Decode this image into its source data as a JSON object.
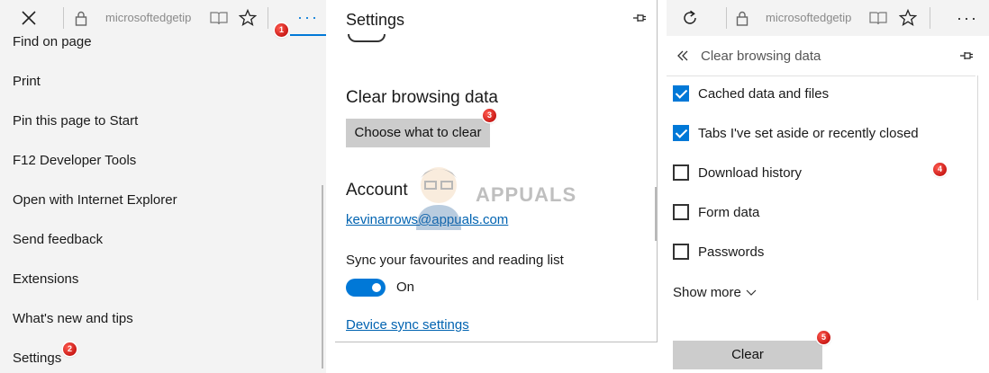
{
  "panel1": {
    "toolbar": {
      "url": "microsoftedgetip",
      "close_icon": "close-icon",
      "lock_icon": "lock-icon",
      "reading_icon": "reading-view-icon",
      "favorite_icon": "star-icon",
      "more": "···"
    },
    "badge": "1",
    "menu": [
      "Find on page",
      "Print",
      "Pin this page to Start",
      "F12 Developer Tools",
      "Open with Internet Explorer",
      "Send feedback",
      "Extensions",
      "What's new and tips",
      "Settings"
    ],
    "settings_badge": "2"
  },
  "panel2": {
    "title": "Settings",
    "pin_icon": "pin-icon",
    "clear_heading": "Clear browsing data",
    "choose_button": "Choose what to clear",
    "choose_badge": "3",
    "account_heading": "Account",
    "account_email": "kevinarrows@appuals.com",
    "sync_label": "Sync your favourites and reading list",
    "toggle_state": "On",
    "device_sync_link": "Device sync settings",
    "watermark_text": "APPUALS"
  },
  "panel3": {
    "toolbar": {
      "url": "microsoftedgetip",
      "refresh_icon": "refresh-icon",
      "more": "···"
    },
    "back_icon": "double-chevron-left-icon",
    "title": "Clear browsing data",
    "items": [
      {
        "label": "Cached data and files",
        "checked": true
      },
      {
        "label": "Tabs I've set aside or recently closed",
        "checked": true
      },
      {
        "label": "Download history",
        "checked": false
      },
      {
        "label": "Form data",
        "checked": false
      },
      {
        "label": "Passwords",
        "checked": false
      }
    ],
    "items_badge": "4",
    "show_more": "Show more",
    "clear_button": "Clear",
    "clear_badge": "5"
  },
  "colors": {
    "accent": "#0078d7",
    "link": "#0063b1",
    "badge": "#d40000",
    "button_gray": "#cccccc"
  }
}
